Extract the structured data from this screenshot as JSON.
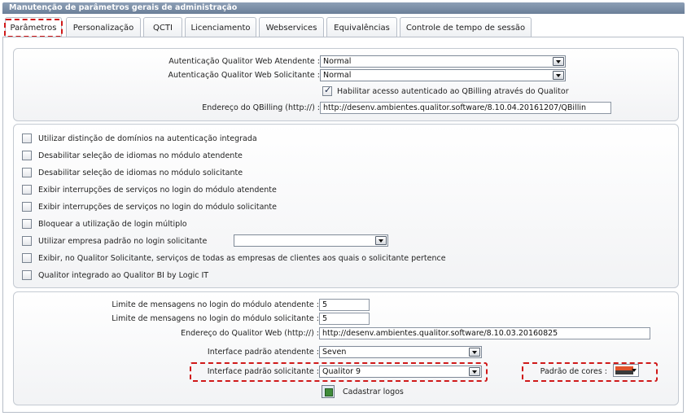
{
  "window": {
    "title": "Manutenção de parâmetros gerais de administração"
  },
  "tabs": [
    {
      "label": "Parâmetros"
    },
    {
      "label": "Personalização"
    },
    {
      "label": "QCTI"
    },
    {
      "label": "Licenciamento"
    },
    {
      "label": "Webservices"
    },
    {
      "label": "Equivalências"
    },
    {
      "label": "Controle de tempo de sessão"
    }
  ],
  "auth": {
    "atendente_label": "Autenticação Qualitor Web Atendente :",
    "atendente_value": "Normal",
    "solicitante_label": "Autenticação Qualitor Web Solicitante :",
    "solicitante_value": "Normal",
    "qbilling_check_label": "Habilitar acesso autenticado ao QBilling através do Qualitor",
    "qbilling_url_label": "Endereço do QBilling (http://) :",
    "qbilling_url_value": "http://desenv.ambientes.qualitor.software/8.10.04.20161207/QBillin"
  },
  "options": {
    "items": [
      {
        "label": "Utilizar distinção de domínios na autenticação integrada"
      },
      {
        "label": "Desabilitar seleção de idiomas no módulo atendente"
      },
      {
        "label": "Desabilitar seleção de idiomas no módulo solicitante"
      },
      {
        "label": "Exibir interrupções de serviços no login do módulo atendente"
      },
      {
        "label": "Exibir interrupções de serviços no login do módulo solicitante"
      },
      {
        "label": "Bloquear a utilização de login múltiplo"
      },
      {
        "label": "Utilizar empresa padrão no login solicitante"
      },
      {
        "label": "Exibir, no Qualitor Solicitante, serviços de todas as empresas de clientes aos quais o solicitante pertence"
      },
      {
        "label": "Qualitor integrado ao Qualitor BI by Logic IT"
      }
    ],
    "empresa_select_value": ""
  },
  "login": {
    "limite_atendente_label": "Limite de mensagens no login do módulo atendente :",
    "limite_atendente_value": "5",
    "limite_solicitante_label": "Limite de mensagens no login do módulo solicitante :",
    "limite_solicitante_value": "5",
    "endereco_label": "Endereço do Qualitor Web (http://) :",
    "endereco_value": "http://desenv.ambientes.qualitor.software/8.10.03.20160825",
    "interface_atendente_label": "Interface padrão atendente :",
    "interface_atendente_value": "Seven",
    "interface_solicitante_label": "Interface padrão solicitante :",
    "interface_solicitante_value": "Qualitor 9",
    "padrao_cores_label": "Padrão de cores :",
    "cadastrar_logos_label": "Cadastrar logos"
  },
  "colors": {
    "titlebar": "#6b7f98",
    "highlight": "#d01919",
    "swatch_top": "#e0532b",
    "swatch_bottom": "#3a3a3a"
  }
}
